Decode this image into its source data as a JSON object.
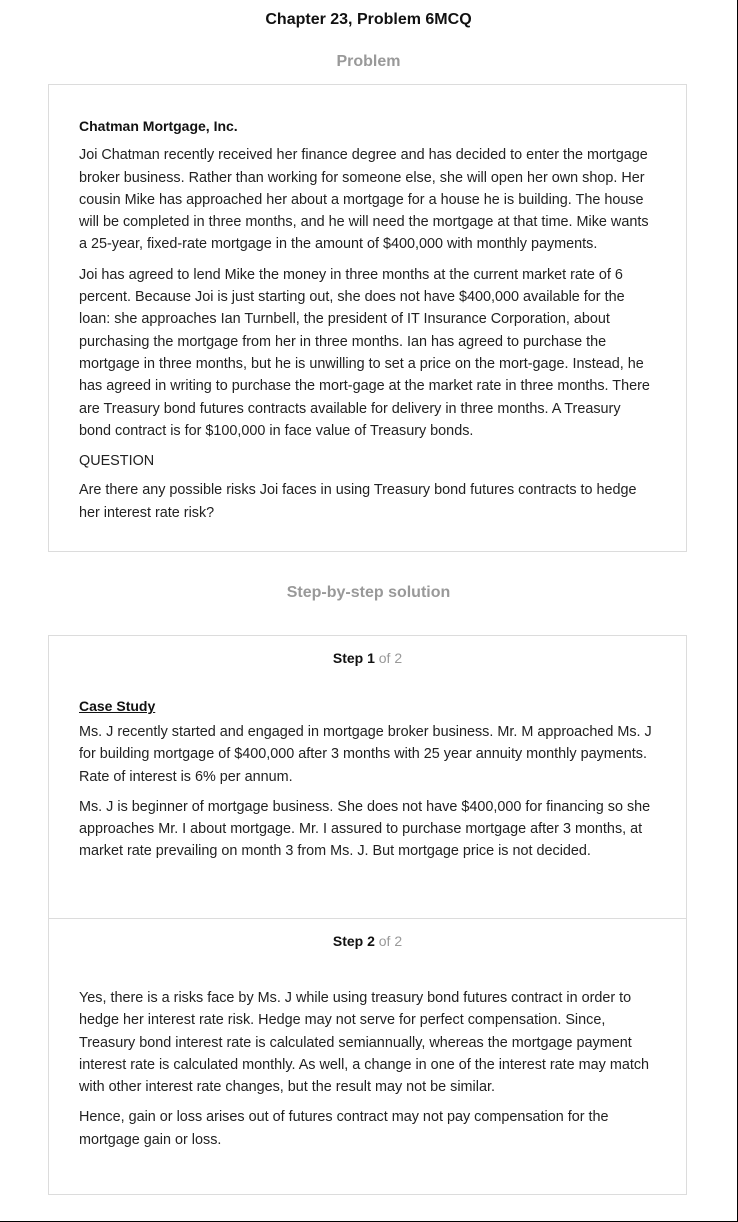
{
  "page": {
    "title": "Chapter 23, Problem 6MCQ"
  },
  "problem": {
    "heading": "Problem",
    "company": "Chatman Mortgage, Inc.",
    "paragraphs": [
      "Joi Chatman recently received her finance degree and has decided to enter the mortgage broker business. Rather than working for someone else, she will open her own shop. Her cousin Mike has approached her about a mortgage for a house he is building. The house will be completed in three months, and he will need the mortgage at that time. Mike wants a 25-year, fixed-rate mortgage in the amount of $400,000 with monthly payments.",
      "Joi has agreed to lend Mike the money in three months at the current market rate of 6 percent. Because Joi is just starting out, she does not have $400,000 available for the loan: she approaches Ian Turnbell, the president of IT Insurance Corporation, about purchasing the mortgage from her in three months. Ian has agreed to purchase the mortgage in three months, but he is unwilling to set a price on the mort-gage. Instead, he has agreed in writing to purchase the mort-gage at the market rate in three months. There are Treasury bond futures contracts available for delivery in three months. A Treasury bond contract is for $100,000 in face value of Treasury bonds."
    ],
    "question_label": "QUESTION",
    "question": "Are there any possible risks Joi faces in using Treasury bond futures contracts to hedge her interest rate risk?"
  },
  "solution": {
    "heading": "Step-by-step solution",
    "steps": [
      {
        "word": "Step 1",
        "of": "of 2",
        "subheading": "Case Study",
        "paragraphs": [
          "Ms. J recently started and engaged in mortgage broker business. Mr. M approached Ms. J for building mortgage of $400,000 after 3 months with 25 year annuity monthly payments. Rate of interest is 6% per annum.",
          "Ms. J is beginner of mortgage business. She does not have $400,000 for financing so she approaches Mr. I about mortgage. Mr. I assured to purchase mortgage after 3 months, at market rate prevailing on month 3 from Ms. J. But mortgage price is not decided."
        ]
      },
      {
        "word": "Step 2",
        "of": "of 2",
        "paragraphs": [
          "Yes, there is a risks face by Ms. J while using treasury bond futures contract in order to hedge her interest rate risk. Hedge may not serve for perfect compensation. Since, Treasury bond interest rate is calculated semiannually, whereas the mortgage payment interest rate is calculated monthly. As well, a change in one of the interest rate may match with other interest rate changes, but the result may not be similar.",
          "Hence, gain or loss arises out of futures contract may not pay compensation for the mortgage gain or loss."
        ]
      }
    ]
  }
}
